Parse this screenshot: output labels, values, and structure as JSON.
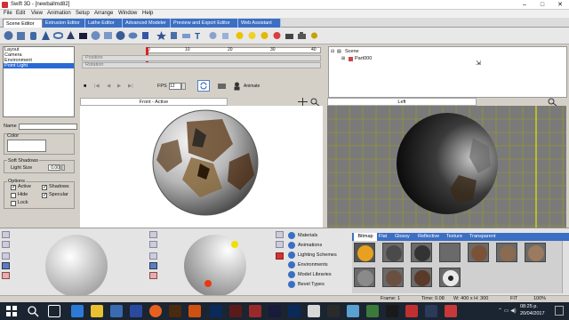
{
  "window": {
    "title": "Swift 3D - [newballmd82]",
    "min": "–",
    "max": "□",
    "close": "✕"
  },
  "menu": [
    "File",
    "Edit",
    "View",
    "Animation",
    "Setup",
    "Arrange",
    "Window",
    "Help"
  ],
  "tabs": [
    "Scene Editor",
    "Extrusion Editor",
    "Lathe Editor",
    "Advanced Modeler",
    "Preview and Export Editor",
    "Web Assistant"
  ],
  "toolbar_icons": [
    "sphere-icon",
    "cube-icon",
    "cylinder-icon",
    "cone-icon",
    "torus-icon",
    "pyramid-icon",
    "plane-icon",
    "shape-icon",
    "star-icon",
    "text-icon",
    "light-icon",
    "camera-icon"
  ],
  "scene_list": {
    "items": [
      "Layout",
      "Camera",
      "Environment",
      "Point Light"
    ],
    "selected": 3
  },
  "properties": {
    "name_label": "Name",
    "name_value": "",
    "color_label": "Color",
    "soft_shadows_label": "Soft Shadows",
    "light_size_label": "Light Size",
    "light_size_value": "0.00",
    "options_label": "Options",
    "options": [
      {
        "label": "Active",
        "checked": true
      },
      {
        "label": "Shadows",
        "checked": true
      },
      {
        "label": "Hide",
        "checked": false
      },
      {
        "label": "Specular",
        "checked": true
      },
      {
        "label": "Lock",
        "checked": false
      }
    ]
  },
  "timeline": {
    "ticks": [
      "0",
      "10",
      "20",
      "30",
      "40"
    ],
    "tracks": [
      "Position",
      "Rotation"
    ],
    "fps_label": "FPS",
    "fps_value": "12",
    "animate_label": "Animate"
  },
  "scene_tree": {
    "root": "Scene",
    "child": "Part000"
  },
  "viewports": {
    "front": "Front - Active",
    "left": "Left"
  },
  "gallery": {
    "categories": [
      "Materials",
      "Animations",
      "Lighting Schemes",
      "Environments",
      "Model Libraries",
      "Bevel Types"
    ],
    "tabs": [
      "Bitmap",
      "Flat",
      "Glossy",
      "Reflective",
      "Texture",
      "Transparent"
    ],
    "active_tab": 0
  },
  "status": {
    "frame": "Frame: 1",
    "time": "Time: 0.08",
    "size": "W: 400 x H: 300",
    "fit": "FIT",
    "zoom": "100%"
  },
  "taskbar": {
    "time": "08:25 p.",
    "date": "20/04/2017"
  },
  "colors": {
    "tab_blue": "#3b6fc4",
    "selection": "#2a6ad4",
    "grid_lines": "#e6e600",
    "taskbar": "#1b2431"
  }
}
